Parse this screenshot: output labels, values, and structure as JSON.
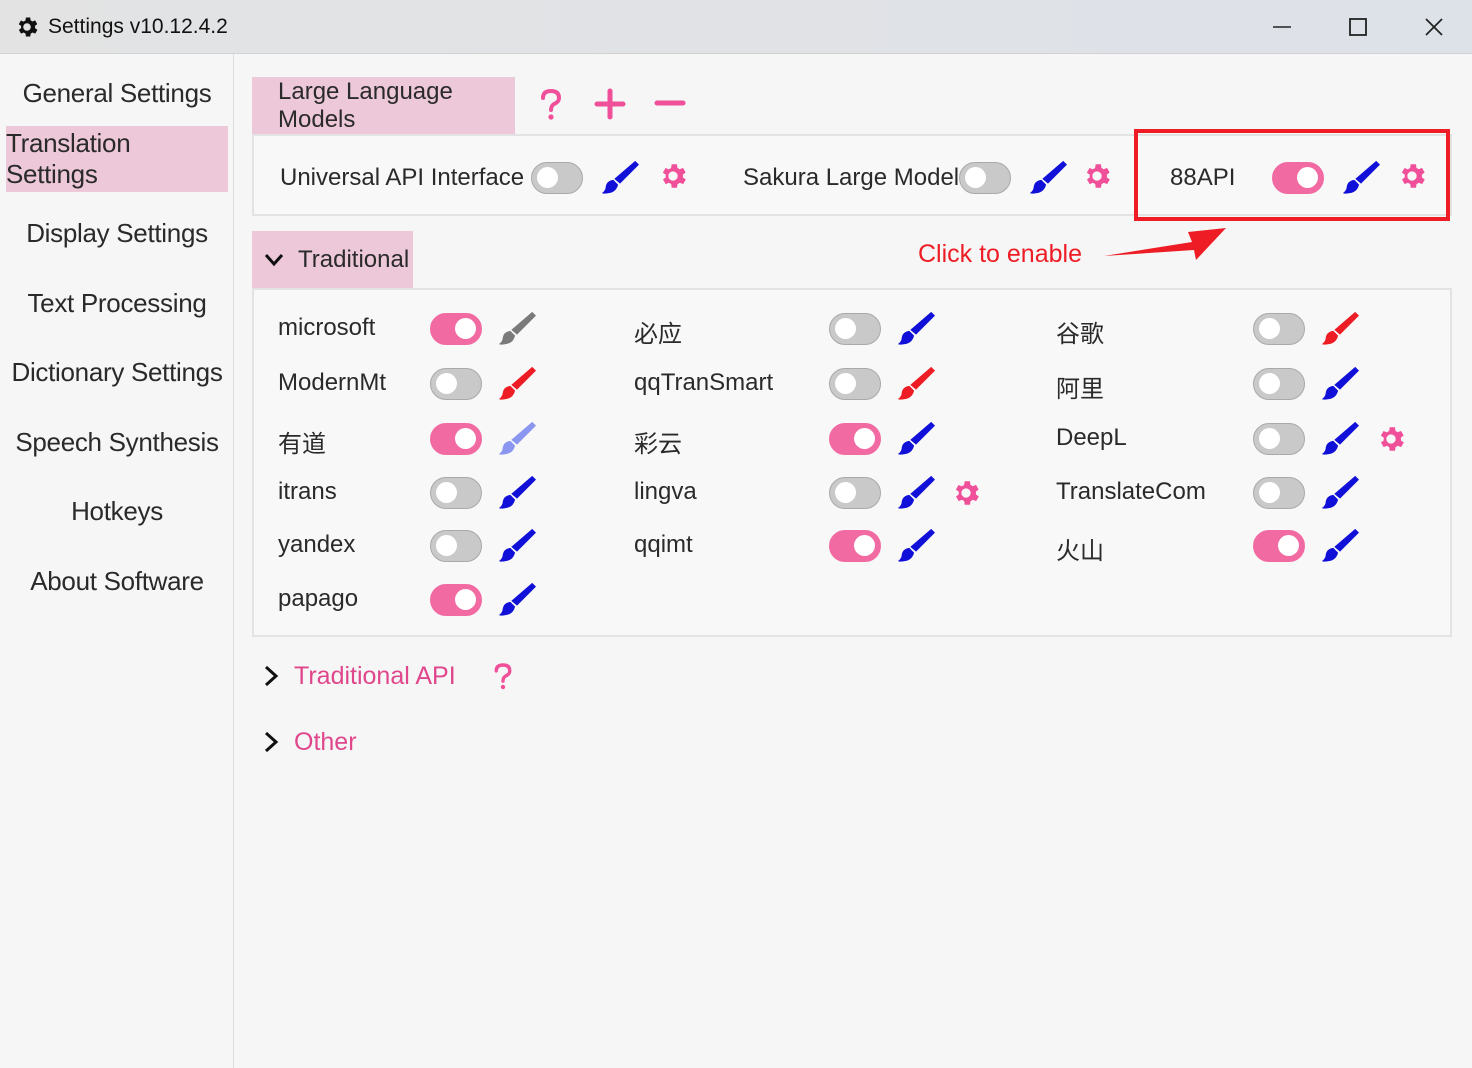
{
  "window": {
    "title": "Settings v10.12.4.2",
    "icon": "gear-icon"
  },
  "sidebar": {
    "items": [
      {
        "label": "General Settings",
        "active": false
      },
      {
        "label": "Translation Settings",
        "active": true
      },
      {
        "label": "Display Settings",
        "active": false
      },
      {
        "label": "Text Processing",
        "active": false
      },
      {
        "label": "Dictionary Settings",
        "active": false
      },
      {
        "label": "Speech Synthesis",
        "active": false
      },
      {
        "label": "Hotkeys",
        "active": false
      },
      {
        "label": "About Software",
        "active": false
      }
    ]
  },
  "llm": {
    "header": "Large Language Models",
    "tools": [
      "question-icon",
      "plus-icon",
      "minus-icon"
    ],
    "items": [
      {
        "label": "Universal API Interface",
        "enabled": false,
        "brush_color": "#1010d8",
        "gear": true
      },
      {
        "label": "Sakura Large Model",
        "enabled": false,
        "brush_color": "#1010d8",
        "gear": true
      },
      {
        "label": "88API",
        "enabled": true,
        "brush_color": "#1010d8",
        "gear": true
      }
    ]
  },
  "traditional": {
    "header": "Traditional",
    "items": [
      {
        "label": "microsoft",
        "enabled": true,
        "brush_color": "#7a7a7a",
        "gear": false
      },
      {
        "label": "必应",
        "enabled": false,
        "brush_color": "#1010d8",
        "gear": false
      },
      {
        "label": "谷歌",
        "enabled": false,
        "brush_color": "#ee1c24",
        "gear": false
      },
      {
        "label": "ModernMt",
        "enabled": false,
        "brush_color": "#ee1c24",
        "gear": false
      },
      {
        "label": "qqTranSmart",
        "enabled": false,
        "brush_color": "#ee1c24",
        "gear": false
      },
      {
        "label": "阿里",
        "enabled": false,
        "brush_color": "#1010d8",
        "gear": false
      },
      {
        "label": "有道",
        "enabled": true,
        "brush_color": "#8a96f0",
        "gear": false
      },
      {
        "label": "彩云",
        "enabled": true,
        "brush_color": "#1010d8",
        "gear": false
      },
      {
        "label": "DeepL",
        "enabled": false,
        "brush_color": "#1010d8",
        "gear": true
      },
      {
        "label": "itrans",
        "enabled": false,
        "brush_color": "#1010d8",
        "gear": false
      },
      {
        "label": "lingva",
        "enabled": false,
        "brush_color": "#1010d8",
        "gear": true
      },
      {
        "label": "TranslateCom",
        "enabled": false,
        "brush_color": "#1010d8",
        "gear": false
      },
      {
        "label": "yandex",
        "enabled": false,
        "brush_color": "#1010d8",
        "gear": false
      },
      {
        "label": "qqimt",
        "enabled": true,
        "brush_color": "#1010d8",
        "gear": false
      },
      {
        "label": "火山",
        "enabled": true,
        "brush_color": "#1010d8",
        "gear": false
      },
      {
        "label": "papago",
        "enabled": true,
        "brush_color": "#1010d8",
        "gear": false
      }
    ]
  },
  "sections": [
    {
      "label": "Traditional API",
      "help": true
    },
    {
      "label": "Other",
      "help": false
    }
  ],
  "annotation": {
    "text": "Click to enable",
    "color": "#ee1c24"
  },
  "colors": {
    "accent_pink": "#f16aa2",
    "header_pink": "#ecc8d8",
    "link_pink": "#e0468c"
  }
}
